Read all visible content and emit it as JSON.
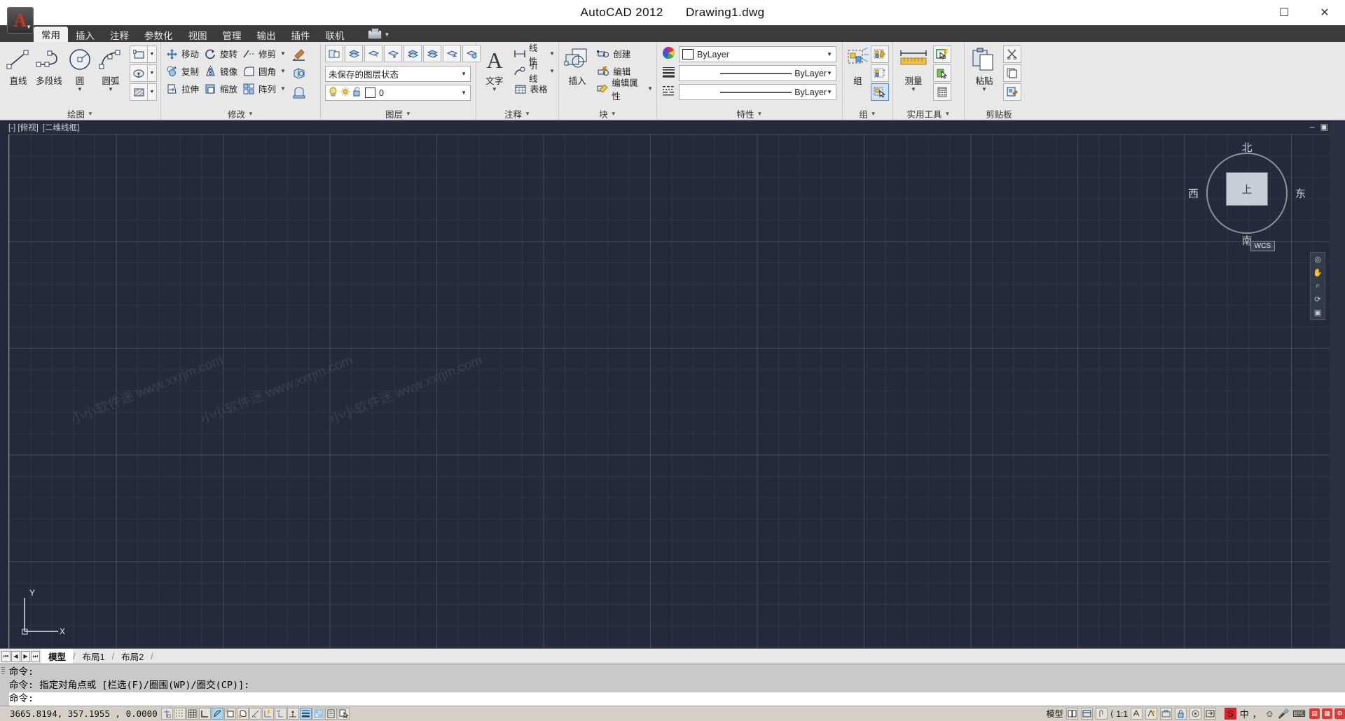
{
  "window": {
    "title_app": "AutoCAD 2012",
    "title_doc": "Drawing1.dwg",
    "btn_maximize": "☐",
    "btn_close": "✕"
  },
  "ribbon_tabs": [
    {
      "label": "常用",
      "active": true
    },
    {
      "label": "插入",
      "active": false
    },
    {
      "label": "注释",
      "active": false
    },
    {
      "label": "参数化",
      "active": false
    },
    {
      "label": "视图",
      "active": false
    },
    {
      "label": "管理",
      "active": false
    },
    {
      "label": "输出",
      "active": false
    },
    {
      "label": "插件",
      "active": false
    },
    {
      "label": "联机",
      "active": false
    }
  ],
  "panels": {
    "draw": {
      "label": "绘图",
      "big_buttons": [
        {
          "label": "直线",
          "icon": "line-icon",
          "dropdown": false
        },
        {
          "label": "多段线",
          "icon": "polyline-icon",
          "dropdown": false
        },
        {
          "label": "圆",
          "icon": "circle-icon",
          "dropdown": true
        },
        {
          "label": "圆弧",
          "icon": "arc-icon",
          "dropdown": true
        }
      ],
      "small_buttons": [
        {
          "icon": "rectangle-icon"
        },
        {
          "icon": "ellipse-icon"
        },
        {
          "icon": "hatch-icon"
        }
      ]
    },
    "modify": {
      "label": "修改",
      "items": [
        {
          "label": "移动",
          "icon": "move-icon",
          "dropdown": false
        },
        {
          "label": "旋转",
          "icon": "rotate-icon",
          "dropdown": false
        },
        {
          "label": "修剪",
          "icon": "trim-icon",
          "dropdown": true
        },
        {
          "label": "复制",
          "icon": "copy-icon",
          "dropdown": false
        },
        {
          "label": "镜像",
          "icon": "mirror-icon",
          "dropdown": false
        },
        {
          "label": "圆角",
          "icon": "fillet-icon",
          "dropdown": true
        },
        {
          "label": "拉伸",
          "icon": "stretch-icon",
          "dropdown": false
        },
        {
          "label": "缩放",
          "icon": "scale-icon",
          "dropdown": false
        },
        {
          "label": "阵列",
          "icon": "array-icon",
          "dropdown": true
        }
      ],
      "side_buttons": [
        {
          "icon": "match-properties-icon"
        },
        {
          "icon": "3d-solid-icon"
        },
        {
          "icon": "extrude-icon"
        }
      ]
    },
    "layer": {
      "label": "图层",
      "toolbar_icons": [
        "layer-properties-icon",
        "layer-new-icon",
        "layer-state-icon",
        "layer-freeze-icon",
        "layer-isolate-icon",
        "layer-off-icon",
        "layer-previous-icon",
        "layer-match-icon"
      ],
      "state_combo": "未保存的图层状态",
      "current_layer": "0",
      "layer_flag_icons": [
        "lightbulb-icon",
        "sun-icon",
        "unlock-icon",
        "color-swatch-icon"
      ]
    },
    "annotation": {
      "label": "注释",
      "big_button": {
        "label": "文字",
        "icon": "text-a-icon",
        "dropdown": true
      },
      "items": [
        {
          "label": "线性",
          "icon": "linear-dimension-icon",
          "dropdown": true
        },
        {
          "label": "引线",
          "icon": "leader-icon",
          "dropdown": true
        },
        {
          "label": "表格",
          "icon": "table-icon",
          "dropdown": false
        }
      ]
    },
    "block": {
      "label": "块",
      "big_button": {
        "label": "插入",
        "icon": "insert-block-icon"
      },
      "items": [
        {
          "label": "创建",
          "icon": "create-block-icon",
          "dropdown": false
        },
        {
          "label": "编辑",
          "icon": "edit-block-icon",
          "dropdown": false
        },
        {
          "label": "编辑属性",
          "icon": "edit-attribute-icon",
          "dropdown": true
        }
      ]
    },
    "properties": {
      "label": "特性",
      "rows": [
        {
          "icon": "color-wheel-icon",
          "value": "ByLayer",
          "swatch": "#ffffff"
        },
        {
          "icon": "linewidth-icon",
          "value": "ByLayer"
        },
        {
          "icon": "linetype-icon",
          "value": "ByLayer"
        }
      ]
    },
    "group": {
      "label": "组",
      "big_label": "组",
      "buttons": [
        {
          "icon": "group-edit-icon",
          "selected": false
        },
        {
          "icon": "group-add-remove-icon",
          "selected": false
        },
        {
          "icon": "group-selection-icon",
          "selected": true
        }
      ],
      "left_icons": [
        "group-create-icon",
        "ungroup-icon"
      ]
    },
    "utilities": {
      "label": "实用工具",
      "big_button": {
        "label": "测量",
        "icon": "measure-ruler-icon",
        "dropdown": true
      },
      "buttons": [
        "quick-select-icon",
        "select-similar-icon",
        "calculator-icon"
      ]
    },
    "clipboard": {
      "label": "剪贴板",
      "big_button": {
        "label": "粘贴",
        "icon": "paste-icon",
        "dropdown": true
      },
      "buttons": [
        "cut-icon",
        "copy-clip-icon",
        "paste-special-icon"
      ]
    }
  },
  "viewport": {
    "header_view": "[-] [俯视]",
    "header_style": "[二维线框]",
    "minimize": "–",
    "restore": "▣",
    "close": "✕",
    "watermarks": [
      "小小软件迷 www.xxrjm.com",
      "小小软件迷 www.xxrjm.com",
      "小小软件迷 www.xxrjm.com"
    ],
    "viewcube": {
      "north": "北",
      "south": "南",
      "east": "东",
      "west": "西",
      "top_label": "上",
      "wcs": "WCS"
    },
    "ucs": {
      "x": "X",
      "y": "Y"
    }
  },
  "layout_tabs": {
    "nav_buttons": [
      "⏮",
      "◀",
      "▶",
      "⏭"
    ],
    "tabs": [
      {
        "label": "模型",
        "active": true
      },
      {
        "label": "布局1",
        "active": false
      },
      {
        "label": "布局2",
        "active": false
      }
    ]
  },
  "command_line": {
    "lines": [
      "命令:",
      "命令: 指定对角点或 [栏选(F)/圈围(WP)/圈交(CP)]:"
    ],
    "prompt": "命令:"
  },
  "status_bar": {
    "coordinates": "3665.8194,  357.1955 ,  0.0000",
    "toggle_icons": [
      {
        "name": "infer-constraints-icon",
        "on": false
      },
      {
        "name": "snap-mode-icon",
        "on": false
      },
      {
        "name": "grid-display-icon",
        "on": false
      },
      {
        "name": "ortho-mode-icon",
        "on": false
      },
      {
        "name": "polar-tracking-icon",
        "on": true
      },
      {
        "name": "object-snap-icon",
        "on": false
      },
      {
        "name": "3d-object-snap-icon",
        "on": false
      },
      {
        "name": "object-snap-tracking-icon",
        "on": false
      },
      {
        "name": "ucs-icon",
        "on": false
      },
      {
        "name": "dynamic-ucs-icon",
        "on": false
      },
      {
        "name": "dynamic-input-icon",
        "on": false
      },
      {
        "name": "lineweight-icon",
        "on": true
      },
      {
        "name": "transparency-icon",
        "on": false
      },
      {
        "name": "quick-properties-icon",
        "on": false
      }
    ],
    "model_label": "模型",
    "scale_label": "1:1",
    "annotation_icon": "annotation-scale-icon",
    "tray_icons": [
      "ime-icon",
      "chinese-mode",
      "comma-period",
      "smiley-icon",
      "mic-icon",
      "keyboard-icon",
      "toolbox-icon"
    ],
    "ime_chinese": "中",
    "ime_punct": "，"
  }
}
